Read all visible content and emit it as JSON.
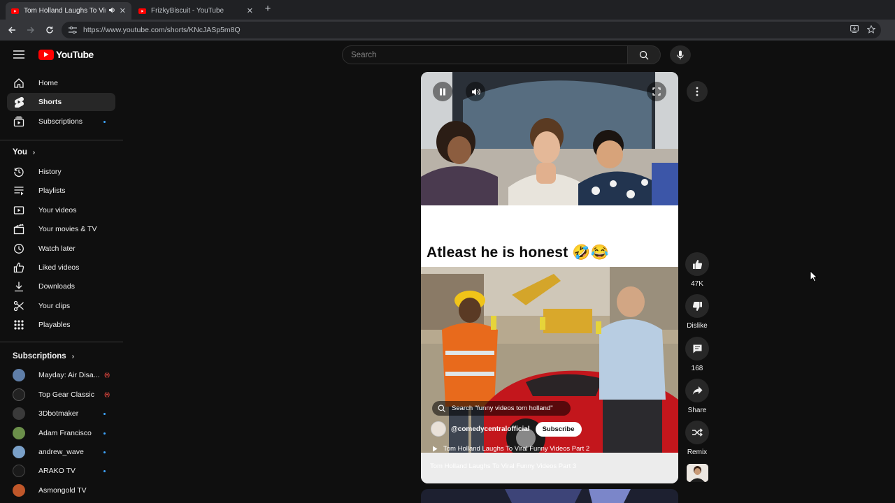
{
  "browser": {
    "tabs": [
      {
        "title": "Tom Holland Laughs To Vir",
        "active": true
      },
      {
        "title": "FrizkyBiscuit - YouTube",
        "active": false
      }
    ],
    "url": "https://www.youtube.com/shorts/KNcJASp5m8Q"
  },
  "header": {
    "logo_text": "YouTube",
    "search_placeholder": "Search"
  },
  "sidebar": {
    "main": [
      {
        "label": "Home",
        "icon": "home-icon"
      },
      {
        "label": "Shorts",
        "icon": "shorts-icon",
        "active": true
      },
      {
        "label": "Subscriptions",
        "icon": "subscriptions-icon",
        "dot": true
      }
    ],
    "you_heading": "You",
    "you": [
      {
        "label": "History",
        "icon": "history-icon"
      },
      {
        "label": "Playlists",
        "icon": "playlists-icon"
      },
      {
        "label": "Your videos",
        "icon": "your-videos-icon"
      },
      {
        "label": "Your movies & TV",
        "icon": "movies-icon"
      },
      {
        "label": "Watch later",
        "icon": "clock-icon"
      },
      {
        "label": "Liked videos",
        "icon": "thumbs-up-icon"
      },
      {
        "label": "Downloads",
        "icon": "download-icon"
      },
      {
        "label": "Your clips",
        "icon": "scissors-icon"
      },
      {
        "label": "Playables",
        "icon": "playables-icon"
      }
    ],
    "subscriptions_heading": "Subscriptions",
    "subscriptions": [
      {
        "label": "Mayday: Air Disa...",
        "status": "live",
        "color": "#5f7ea8"
      },
      {
        "label": "Top Gear Classic",
        "status": "live",
        "color": "#222222"
      },
      {
        "label": "3Dbotmaker",
        "status": "dot",
        "color": "#3a3a3a"
      },
      {
        "label": "Adam Francisco",
        "status": "dot",
        "color": "#6b8f4a"
      },
      {
        "label": "andrew_wave",
        "status": "dot",
        "color": "#7aa0c8"
      },
      {
        "label": "ARAKO TV",
        "status": "dot",
        "color": "#1a1a1a"
      },
      {
        "label": "Asmongold TV",
        "status": "",
        "color": "#c0572a"
      }
    ]
  },
  "short": {
    "caption": "Atleast he is honest 🤣😂",
    "search_suggestion": "Search \"funny videos tom holland\"",
    "channel": "@comedycentralofficial",
    "subscribe_label": "Subscribe",
    "playlist_item": "Tom Holland Laughs To Viral Funny Videos Part 2",
    "title": "Tom Holland Laughs To Viral Funny Videos Part 3"
  },
  "actions": {
    "like_count": "47K",
    "dislike_label": "Dislike",
    "comment_count": "168",
    "share_label": "Share",
    "remix_label": "Remix"
  }
}
